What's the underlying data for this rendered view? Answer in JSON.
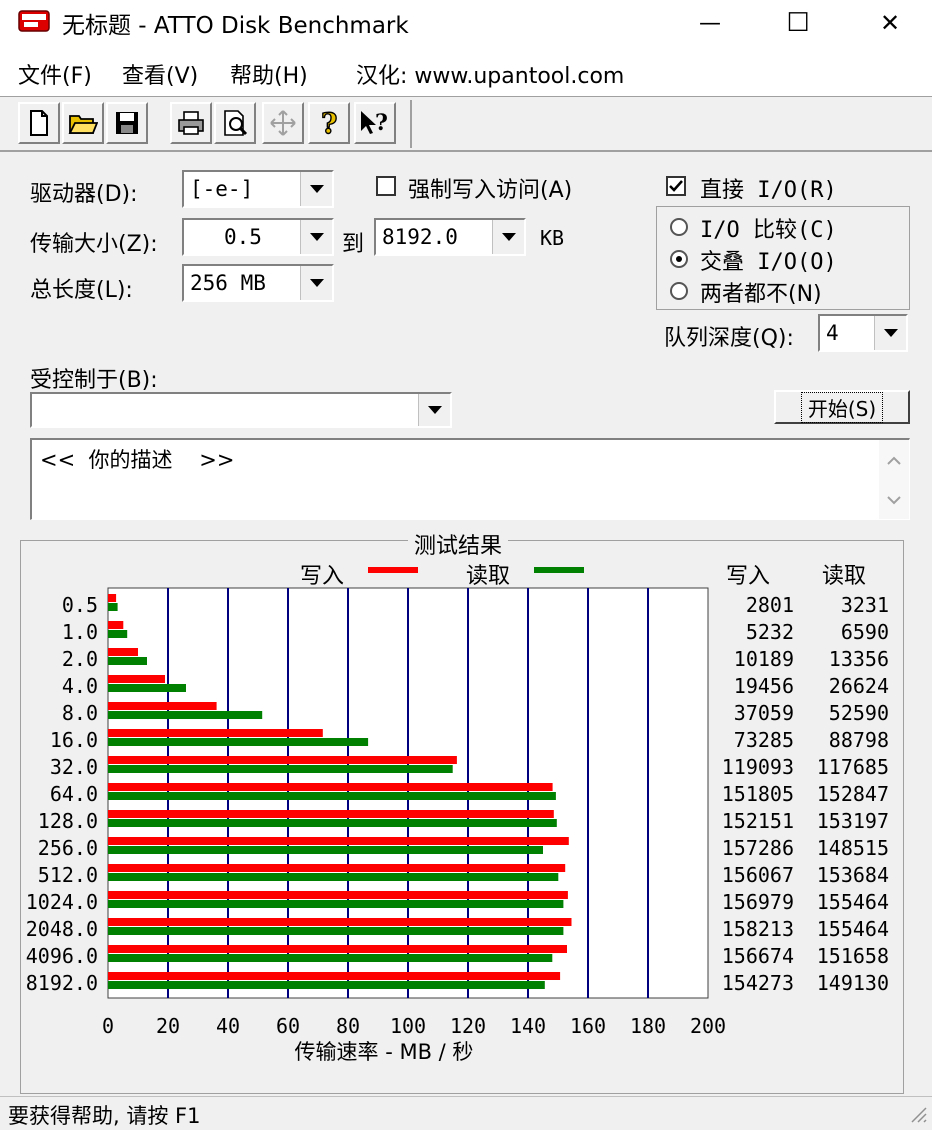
{
  "window": {
    "title": "无标题 - ATTO Disk Benchmark",
    "minimize_glyph": "—",
    "maximize_glyph": "☐",
    "close_glyph": "✕"
  },
  "menu": [
    "文件(F)",
    "查看(V)",
    "帮助(H)",
    "汉化: www.upantool.com"
  ],
  "toolbar": [
    "new-doc-icon",
    "open-folder-icon",
    "save-icon",
    "print-icon",
    "print-preview-icon",
    "move-icon",
    "help-icon",
    "context-help-icon"
  ],
  "form": {
    "drive_label": "驱动器(D):",
    "drive_value": "[-e-]",
    "transfer_label": "传输大小(Z):",
    "transfer_from": "0.5",
    "to_label": "到",
    "transfer_to": "8192.0",
    "unit_kb": "KB",
    "length_label": "总长度(L):",
    "length_value": "256 MB",
    "force_write_label": "强制写入访问(A)",
    "force_write_checked": false,
    "direct_io_label": "直接 I/O(R)",
    "direct_io_checked": true,
    "io_options": [
      "I/O 比较(C)",
      "交叠 I/O(O)",
      "两者都不(N)"
    ],
    "io_selected": 1,
    "queue_label": "队列深度(Q):",
    "queue_value": "4",
    "controlled_label": "受控制于(B):",
    "controlled_value": "",
    "start_label": "开始(S)",
    "description": "<<  你的描述    >>"
  },
  "results": {
    "title": "测试结果",
    "write_col": "写入",
    "read_col": "读取",
    "legend_write": "写入",
    "legend_read": "读取",
    "colors": {
      "write": "#ff0000",
      "read": "#008000",
      "grid": "#00007f"
    }
  },
  "chart_data": {
    "type": "bar",
    "orientation": "horizontal",
    "xlabel": "传输速率 - MB / 秒",
    "xlim": [
      0,
      200
    ],
    "xticks": [
      "0",
      "20",
      "40",
      "60",
      "80",
      "100",
      "120",
      "140",
      "160",
      "180",
      "200"
    ],
    "categories": [
      "0.5",
      "1.0",
      "2.0",
      "4.0",
      "8.0",
      "16.0",
      "32.0",
      "64.0",
      "128.0",
      "256.0",
      "512.0",
      "1024.0",
      "2048.0",
      "4096.0",
      "8192.0"
    ],
    "series": [
      {
        "name": "写入",
        "values": [
          2.7,
          5.1,
          10.0,
          19.0,
          36.2,
          71.6,
          116.3,
          148.2,
          148.6,
          153.6,
          152.4,
          153.3,
          154.5,
          153.0,
          150.7
        ]
      },
      {
        "name": "读取",
        "values": [
          3.2,
          6.4,
          13.0,
          26.0,
          51.4,
          86.7,
          114.9,
          149.3,
          149.6,
          145.0,
          150.1,
          151.8,
          151.8,
          148.1,
          145.6
        ]
      }
    ],
    "write_text": [
      "2801",
      "5232",
      "10189",
      "19456",
      "37059",
      "73285",
      "119093",
      "151805",
      "152151",
      "157286",
      "156067",
      "156979",
      "158213",
      "156674",
      "154273"
    ],
    "read_text": [
      "3231",
      "6590",
      "13356",
      "26624",
      "52590",
      "88798",
      "117685",
      "152847",
      "153197",
      "148515",
      "153684",
      "155464",
      "155464",
      "151658",
      "149130"
    ]
  },
  "status": "要获得帮助, 请按 F1"
}
